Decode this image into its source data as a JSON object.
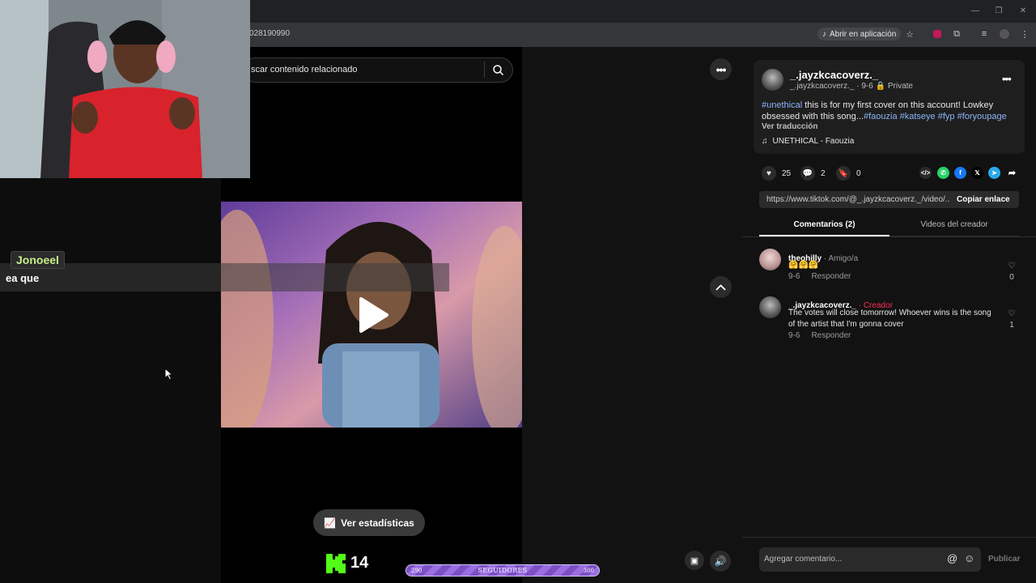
{
  "browser": {
    "url": "028190990",
    "open_in_app": "Abrir en aplicación"
  },
  "chat": {
    "username": "Jonoeel",
    "message": "ea que"
  },
  "search": {
    "placeholder": "scar contenido relacionado"
  },
  "video": {
    "stats_label": "Ver estadísticas"
  },
  "overlay": {
    "k_count": "14",
    "followers_label": "SEGUIDORES",
    "followers_min": "290",
    "followers_max": "300",
    "followers_progress": 0.0
  },
  "post": {
    "username": "_.jayzkcacoverz._",
    "meta_handle": "_.jayzkcacoverz._",
    "meta_date": "9-6",
    "privacy": "Private",
    "caption_tag_1": "#unethical",
    "caption_text": " this is for my first cover on this account! Lowkey obsessed with this song...",
    "caption_tags": [
      "#faouzia",
      "#katseye",
      "#fyp",
      "#foryoupage"
    ],
    "translate": "Ver traducción",
    "music": "UNETHICAL - Faouzia"
  },
  "actions": {
    "likes": "25",
    "comments": "2",
    "saves": "0"
  },
  "link": {
    "url": "https://www.tiktok.com/@_.jayzkcacoverz._/video/...",
    "copy_label": "Copiar enlace"
  },
  "tabs": {
    "comments": "Comentarios (2)",
    "creator_videos": "Videos del creador"
  },
  "comments": [
    {
      "username": "theohilly",
      "tag": " · Amigo/a",
      "text": "🤗🤗🤗",
      "date": "9-6",
      "reply": "Responder",
      "likes": "0"
    },
    {
      "username": "_.jayzkcacoverz._",
      "tag": " · Creador",
      "text": "The votes will close tomorrow! Whoever wins is the song of the artist that I'm gonna cover",
      "date": "9-6",
      "reply": "Responder",
      "likes": "1"
    }
  ],
  "comment_input": {
    "placeholder": "Agregar comentario...",
    "publish": "Publicar"
  },
  "colors": {
    "accent_red": "#fe2c55",
    "hashtag_blue": "#8ab4f8",
    "chat_green": "#c6f08a",
    "followers_purple": "#7c4fc5"
  }
}
